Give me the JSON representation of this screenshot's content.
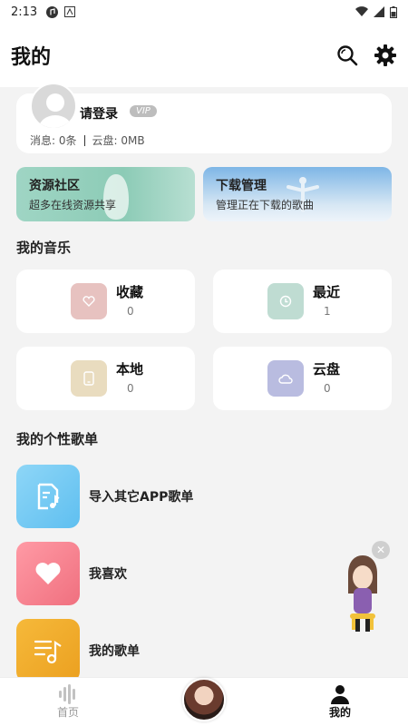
{
  "status_bar": {
    "time": "2:13"
  },
  "header": {
    "title": "我的"
  },
  "profile": {
    "login_text": "请登录",
    "vip_badge": "VIP",
    "messages": "消息: 0条",
    "cloud": "云盘: 0MB"
  },
  "banners": [
    {
      "title": "资源社区",
      "subtitle": "超多在线资源共享"
    },
    {
      "title": "下载管理",
      "subtitle": "管理正在下载的歌曲"
    }
  ],
  "my_music": {
    "title": "我的音乐",
    "items": [
      {
        "label": "收藏",
        "count": "0",
        "color": "#e7c2c0"
      },
      {
        "label": "最近",
        "count": "1",
        "color": "#bfdcd2"
      },
      {
        "label": "本地",
        "count": "0",
        "color": "#e9dcbf"
      },
      {
        "label": "云盘",
        "count": "0",
        "color": "#b9bce0"
      }
    ]
  },
  "playlists": {
    "title": "我的个性歌单",
    "items": [
      {
        "label": "导入其它APP歌单",
        "color": "#6cc7f2"
      },
      {
        "label": "我喜欢",
        "color": "#f47d8c"
      },
      {
        "label": "我的歌单",
        "color": "#f0a928"
      }
    ]
  },
  "bottom_nav": [
    {
      "label": "首页"
    },
    {
      "label": ""
    },
    {
      "label": "我的"
    }
  ]
}
